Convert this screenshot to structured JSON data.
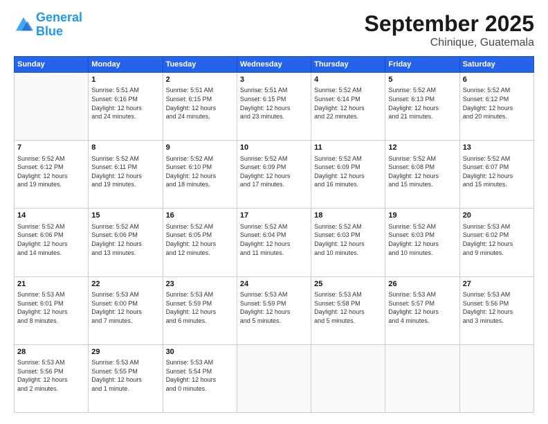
{
  "header": {
    "logo_line1": "General",
    "logo_line2": "Blue",
    "month": "September 2025",
    "location": "Chinique, Guatemala"
  },
  "days_of_week": [
    "Sunday",
    "Monday",
    "Tuesday",
    "Wednesday",
    "Thursday",
    "Friday",
    "Saturday"
  ],
  "weeks": [
    [
      {
        "day": "",
        "lines": []
      },
      {
        "day": "1",
        "lines": [
          "Sunrise: 5:51 AM",
          "Sunset: 6:16 PM",
          "Daylight: 12 hours",
          "and 24 minutes."
        ]
      },
      {
        "day": "2",
        "lines": [
          "Sunrise: 5:51 AM",
          "Sunset: 6:15 PM",
          "Daylight: 12 hours",
          "and 24 minutes."
        ]
      },
      {
        "day": "3",
        "lines": [
          "Sunrise: 5:51 AM",
          "Sunset: 6:15 PM",
          "Daylight: 12 hours",
          "and 23 minutes."
        ]
      },
      {
        "day": "4",
        "lines": [
          "Sunrise: 5:52 AM",
          "Sunset: 6:14 PM",
          "Daylight: 12 hours",
          "and 22 minutes."
        ]
      },
      {
        "day": "5",
        "lines": [
          "Sunrise: 5:52 AM",
          "Sunset: 6:13 PM",
          "Daylight: 12 hours",
          "and 21 minutes."
        ]
      },
      {
        "day": "6",
        "lines": [
          "Sunrise: 5:52 AM",
          "Sunset: 6:12 PM",
          "Daylight: 12 hours",
          "and 20 minutes."
        ]
      }
    ],
    [
      {
        "day": "7",
        "lines": [
          "Sunrise: 5:52 AM",
          "Sunset: 6:12 PM",
          "Daylight: 12 hours",
          "and 19 minutes."
        ]
      },
      {
        "day": "8",
        "lines": [
          "Sunrise: 5:52 AM",
          "Sunset: 6:11 PM",
          "Daylight: 12 hours",
          "and 19 minutes."
        ]
      },
      {
        "day": "9",
        "lines": [
          "Sunrise: 5:52 AM",
          "Sunset: 6:10 PM",
          "Daylight: 12 hours",
          "and 18 minutes."
        ]
      },
      {
        "day": "10",
        "lines": [
          "Sunrise: 5:52 AM",
          "Sunset: 6:09 PM",
          "Daylight: 12 hours",
          "and 17 minutes."
        ]
      },
      {
        "day": "11",
        "lines": [
          "Sunrise: 5:52 AM",
          "Sunset: 6:09 PM",
          "Daylight: 12 hours",
          "and 16 minutes."
        ]
      },
      {
        "day": "12",
        "lines": [
          "Sunrise: 5:52 AM",
          "Sunset: 6:08 PM",
          "Daylight: 12 hours",
          "and 15 minutes."
        ]
      },
      {
        "day": "13",
        "lines": [
          "Sunrise: 5:52 AM",
          "Sunset: 6:07 PM",
          "Daylight: 12 hours",
          "and 15 minutes."
        ]
      }
    ],
    [
      {
        "day": "14",
        "lines": [
          "Sunrise: 5:52 AM",
          "Sunset: 6:06 PM",
          "Daylight: 12 hours",
          "and 14 minutes."
        ]
      },
      {
        "day": "15",
        "lines": [
          "Sunrise: 5:52 AM",
          "Sunset: 6:06 PM",
          "Daylight: 12 hours",
          "and 13 minutes."
        ]
      },
      {
        "day": "16",
        "lines": [
          "Sunrise: 5:52 AM",
          "Sunset: 6:05 PM",
          "Daylight: 12 hours",
          "and 12 minutes."
        ]
      },
      {
        "day": "17",
        "lines": [
          "Sunrise: 5:52 AM",
          "Sunset: 6:04 PM",
          "Daylight: 12 hours",
          "and 11 minutes."
        ]
      },
      {
        "day": "18",
        "lines": [
          "Sunrise: 5:52 AM",
          "Sunset: 6:03 PM",
          "Daylight: 12 hours",
          "and 10 minutes."
        ]
      },
      {
        "day": "19",
        "lines": [
          "Sunrise: 5:52 AM",
          "Sunset: 6:03 PM",
          "Daylight: 12 hours",
          "and 10 minutes."
        ]
      },
      {
        "day": "20",
        "lines": [
          "Sunrise: 5:53 AM",
          "Sunset: 6:02 PM",
          "Daylight: 12 hours",
          "and 9 minutes."
        ]
      }
    ],
    [
      {
        "day": "21",
        "lines": [
          "Sunrise: 5:53 AM",
          "Sunset: 6:01 PM",
          "Daylight: 12 hours",
          "and 8 minutes."
        ]
      },
      {
        "day": "22",
        "lines": [
          "Sunrise: 5:53 AM",
          "Sunset: 6:00 PM",
          "Daylight: 12 hours",
          "and 7 minutes."
        ]
      },
      {
        "day": "23",
        "lines": [
          "Sunrise: 5:53 AM",
          "Sunset: 5:59 PM",
          "Daylight: 12 hours",
          "and 6 minutes."
        ]
      },
      {
        "day": "24",
        "lines": [
          "Sunrise: 5:53 AM",
          "Sunset: 5:59 PM",
          "Daylight: 12 hours",
          "and 5 minutes."
        ]
      },
      {
        "day": "25",
        "lines": [
          "Sunrise: 5:53 AM",
          "Sunset: 5:58 PM",
          "Daylight: 12 hours",
          "and 5 minutes."
        ]
      },
      {
        "day": "26",
        "lines": [
          "Sunrise: 5:53 AM",
          "Sunset: 5:57 PM",
          "Daylight: 12 hours",
          "and 4 minutes."
        ]
      },
      {
        "day": "27",
        "lines": [
          "Sunrise: 5:53 AM",
          "Sunset: 5:56 PM",
          "Daylight: 12 hours",
          "and 3 minutes."
        ]
      }
    ],
    [
      {
        "day": "28",
        "lines": [
          "Sunrise: 5:53 AM",
          "Sunset: 5:56 PM",
          "Daylight: 12 hours",
          "and 2 minutes."
        ]
      },
      {
        "day": "29",
        "lines": [
          "Sunrise: 5:53 AM",
          "Sunset: 5:55 PM",
          "Daylight: 12 hours",
          "and 1 minute."
        ]
      },
      {
        "day": "30",
        "lines": [
          "Sunrise: 5:53 AM",
          "Sunset: 5:54 PM",
          "Daylight: 12 hours",
          "and 0 minutes."
        ]
      },
      {
        "day": "",
        "lines": []
      },
      {
        "day": "",
        "lines": []
      },
      {
        "day": "",
        "lines": []
      },
      {
        "day": "",
        "lines": []
      }
    ]
  ]
}
